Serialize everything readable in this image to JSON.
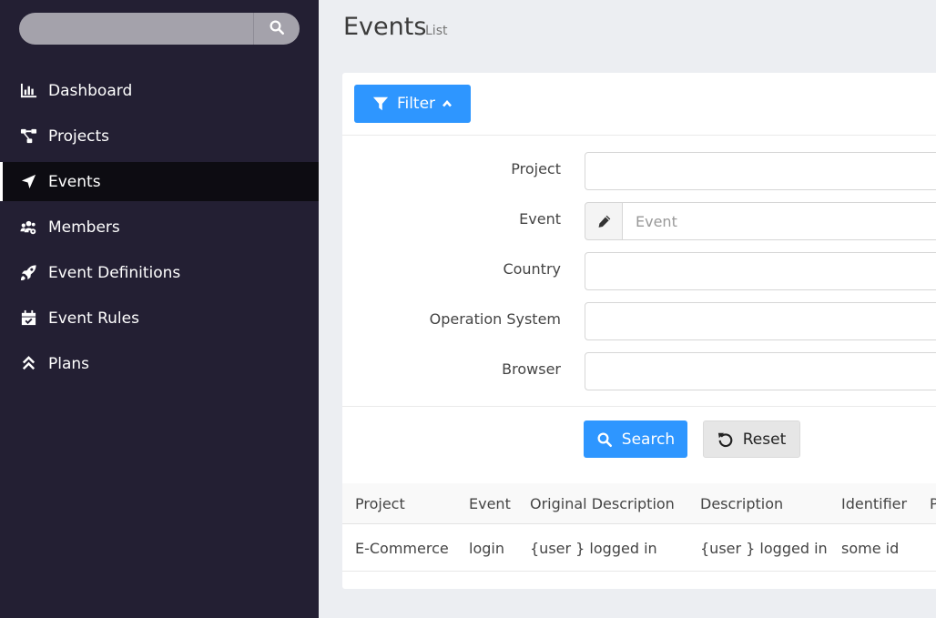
{
  "sidebar": {
    "search_placeholder": "",
    "items": [
      {
        "label": "Dashboard",
        "icon": "chart-bar-icon"
      },
      {
        "label": "Projects",
        "icon": "project-diagram-icon"
      },
      {
        "label": "Events",
        "icon": "location-arrow-icon",
        "active": true
      },
      {
        "label": "Members",
        "icon": "users-cog-icon"
      },
      {
        "label": "Event Definitions",
        "icon": "rocket-icon"
      },
      {
        "label": "Event Rules",
        "icon": "calendar-check-icon"
      },
      {
        "label": "Plans",
        "icon": "angle-double-up-icon"
      }
    ]
  },
  "header": {
    "title": "Events",
    "subtitle": "List"
  },
  "filter": {
    "toggle_label": "Filter",
    "fields": {
      "project_label": "Project",
      "project_value": "",
      "event_label": "Event",
      "event_placeholder": "Event",
      "country_label": "Country",
      "country_value": "",
      "os_label": "Operation System",
      "os_value": "",
      "browser_label": "Browser",
      "browser_value": ""
    },
    "search_label": "Search",
    "reset_label": "Reset"
  },
  "table": {
    "columns": [
      "Project",
      "Event",
      "Original Description",
      "Description",
      "Identifier",
      "P"
    ],
    "rows": [
      [
        "E-Commerce",
        "login",
        "{user } logged in",
        "{user } logged in",
        "some id",
        ""
      ]
    ]
  },
  "colors": {
    "sidebar_bg": "#231f33",
    "active_item_bg": "#0d0c12",
    "primary": "#2e96ff",
    "page_bg": "#eceef2"
  }
}
